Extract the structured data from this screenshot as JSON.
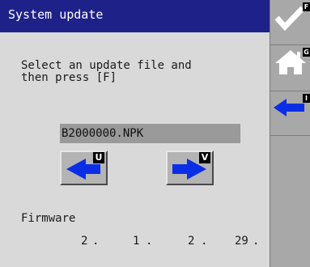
{
  "title": "System update",
  "instruction": "Select an update file and\nthen press [F]",
  "file_name": "B2000000.NPK",
  "prev_button": {
    "icon": "arrow-left-icon",
    "key": "U"
  },
  "next_button": {
    "icon": "arrow-right-icon",
    "key": "V"
  },
  "firmware": {
    "label": "Firmware",
    "version": [
      "2",
      ".",
      "1",
      ".",
      "2",
      ".",
      "29",
      "."
    ]
  },
  "sidebar": [
    {
      "icon": "checkmark-icon",
      "key": "F"
    },
    {
      "icon": "home-icon",
      "key": "G"
    },
    {
      "icon": "back-arrow-icon",
      "key": "I"
    }
  ],
  "colors": {
    "titlebar": "#1e2288",
    "arrow": "#0a2ee6",
    "panel": "#d9d9d9",
    "sidebar": "#a8a8a8"
  }
}
